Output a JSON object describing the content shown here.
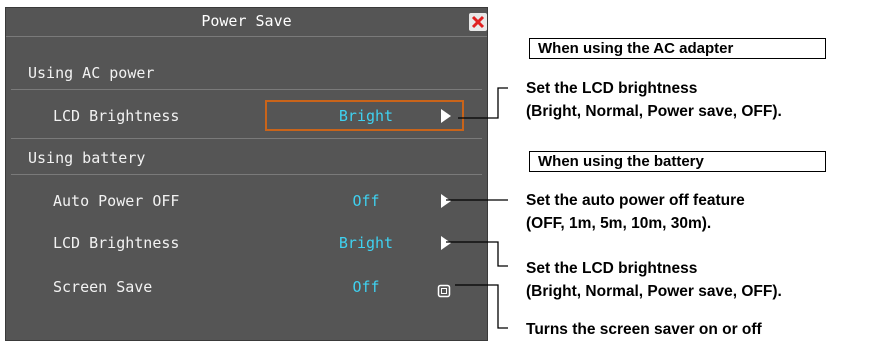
{
  "dialog": {
    "title": "Power Save",
    "close_icon": "close-icon",
    "sections": [
      {
        "heading": "Using AC power",
        "rows": [
          {
            "label": "LCD Brightness",
            "value": "Bright",
            "control": "arrow-right-icon",
            "selected": true
          }
        ]
      },
      {
        "heading": "Using battery",
        "rows": [
          {
            "label": "Auto Power OFF",
            "value": "Off",
            "control": "arrow-right-icon"
          },
          {
            "label": "LCD Brightness",
            "value": "Bright",
            "control": "arrow-right-icon"
          },
          {
            "label": "Screen Save",
            "value": "Off",
            "control": "toggle-icon"
          }
        ]
      }
    ]
  },
  "annotations": {
    "ac_box": "When using the AC adapter",
    "ac_note_line1": "Set the LCD brightness",
    "ac_note_line2": "(Bright, Normal, Power save, OFF).",
    "battery_box": "When using the battery",
    "auto_off_line1": "Set the auto power off feature",
    "auto_off_line2": "(OFF, 1m, 5m, 10m, 30m).",
    "battery_lcd_line1": "Set the LCD brightness",
    "battery_lcd_line2": "(Bright, Normal, Power save, OFF).",
    "screen_save_note": "Turns the screen saver on or off"
  },
  "colors": {
    "panel": "#555555",
    "value_text": "#3fd1f0",
    "highlight_border": "#c9641a",
    "close_x": "#e02020"
  }
}
